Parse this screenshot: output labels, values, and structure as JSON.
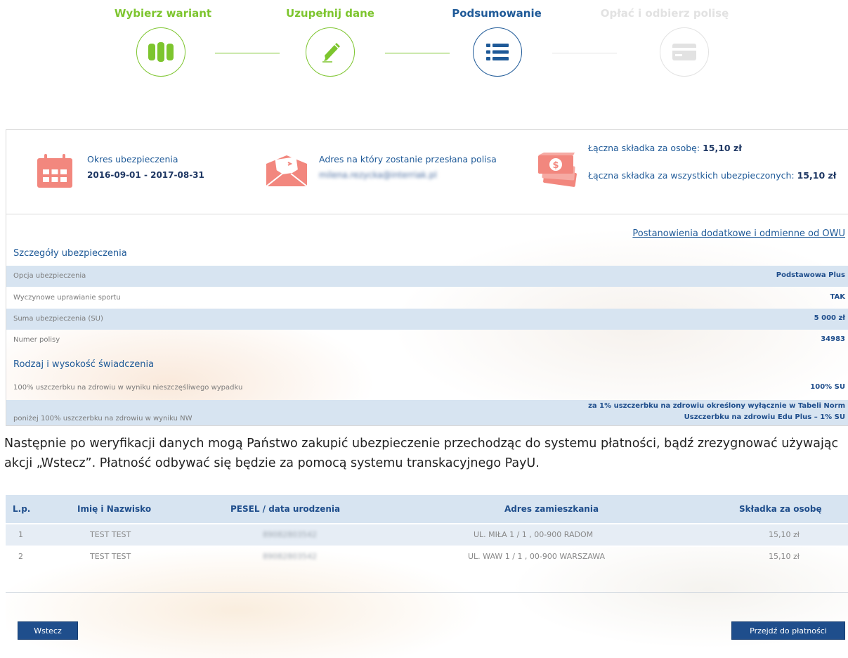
{
  "stepper": {
    "steps": [
      {
        "label": "Wybierz wariant",
        "icon": "columns-icon",
        "color": "#7dc52e"
      },
      {
        "label": "Uzupełnij dane",
        "icon": "pencil-icon",
        "color": "#7dc52e"
      },
      {
        "label": "Podsumowanie",
        "icon": "list-icon",
        "color": "#1f5a98"
      },
      {
        "label": "Opłać i odbierz polisę",
        "icon": "card-icon",
        "color": "#e2e2e2"
      }
    ]
  },
  "summary": {
    "period_label": "Okres ubezpieczenia",
    "period_from": "2016-09-01",
    "period_sep": " - ",
    "period_to": "2017-08-31",
    "address_label": "Adres na który zostanie przesłana polisa",
    "address_value": "milena.rezycka@interriak.pl",
    "premium_person_label": "Łączna składka za osobę:",
    "premium_person_value": "15,10 zł",
    "premium_all_label": "Łączna składka za wszystkich ubezpieczonych:",
    "premium_all_value": "15,10 zł"
  },
  "details": {
    "owu_link": "Postanowienia dodatkowe i odmienne od OWU",
    "section1_title": "Szczegóły ubezpieczenia",
    "rows1": [
      {
        "key": "Opcja ubezpieczenia",
        "value": "Podstawowa Plus"
      },
      {
        "key": "Wyczynowe uprawianie sportu",
        "value": "TAK"
      },
      {
        "key": "Suma ubezpieczenia (SU)",
        "value": "5 000 zł"
      },
      {
        "key": "Numer polisy",
        "value": "34983"
      }
    ],
    "section2_title": "Rodzaj i wysokość świadczenia",
    "rows2": [
      {
        "key": "100% uszczerbku na zdrowiu w wyniku nieszczęśliwego wypadku",
        "value": "100% SU"
      },
      {
        "key": "poniżej 100% uszczerbku na zdrowiu w wyniku NW",
        "value_line1": "za 1% uszczerbku na zdrowiu określony wyłącznie w Tabeli Norm",
        "value_line2": "Uszczerbku na zdrowiu Edu Plus – 1% SU"
      }
    ]
  },
  "paragraph": "Następnie po weryfikacji danych mogą Państwo  zakupić ubezpieczenie przechodząc do systemu płatności, bądź zrezygnować używając akcji „Wstecz”. Płatność odbywać się będzie za pomocą systemu transkacyjnego PayU.",
  "table": {
    "headers": [
      "L.p.",
      "Imię i Nazwisko",
      "PESEL / data urodzenia",
      "Adres zamieszkania",
      "Składka za osobę"
    ],
    "rows": [
      [
        "1",
        "TEST TEST",
        "89082803542",
        "UL. MIŁA 1 / 1 , 00-900 RADOM",
        "15,10 zł"
      ],
      [
        "2",
        "TEST TEST",
        "89082803542",
        "UL. WAW 1 / 1 , 00-900 WARSZAWA",
        "15,10 zł"
      ]
    ]
  },
  "buttons": {
    "back": "Wstecz",
    "pay": "Przejdź do płatności"
  },
  "colors": {
    "green": "#7dc52e",
    "navy": "#1f5a98",
    "inactive": "#e2e2e2",
    "salmon": "#f2877e",
    "row_blue": "#d7e4f1",
    "button": "#1f4e8c"
  }
}
